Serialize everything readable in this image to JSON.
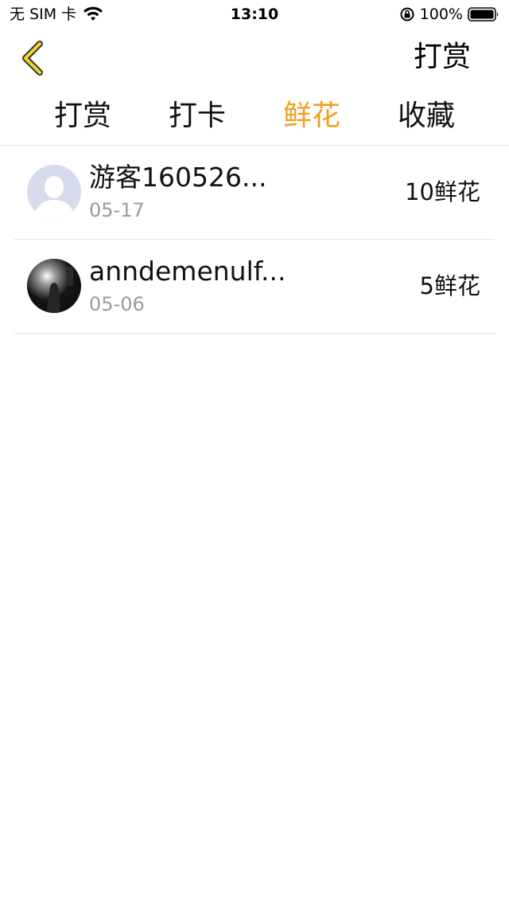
{
  "status_bar": {
    "carrier": "无 SIM 卡",
    "time": "13:10",
    "battery": "100%"
  },
  "nav": {
    "action_label": "打赏",
    "back_icon": "chevron-left-icon",
    "accent_color": "#f0a020"
  },
  "tabs": [
    {
      "label": "打赏",
      "active": false
    },
    {
      "label": "打卡",
      "active": false
    },
    {
      "label": "鲜花",
      "active": true
    },
    {
      "label": "收藏",
      "active": false
    }
  ],
  "list": [
    {
      "name": "游客160526...",
      "date": "05-17",
      "amount": "10鲜花",
      "avatar": "default-avatar"
    },
    {
      "name": "anndemenulf...",
      "date": "05-06",
      "amount": "5鲜花",
      "avatar": "photo-avatar"
    }
  ]
}
